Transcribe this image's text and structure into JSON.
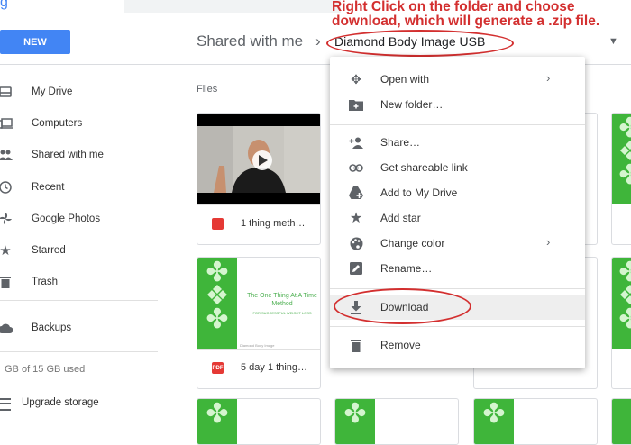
{
  "app": {
    "logo_fragment": "g",
    "new_button": "NEW"
  },
  "breadcrumb": {
    "parent": "Shared with me",
    "current_folder": "Diamond Body Image USB"
  },
  "annotation": {
    "line1": "Right Click on the folder and choose",
    "line2": "download, which will generate a .zip file."
  },
  "sidebar": {
    "items": [
      {
        "label": "My Drive",
        "icon": "my-drive-icon"
      },
      {
        "label": "Computers",
        "icon": "computers-icon"
      },
      {
        "label": "Shared with me",
        "icon": "shared-icon"
      },
      {
        "label": "Recent",
        "icon": "clock-icon"
      },
      {
        "label": "Google Photos",
        "icon": "photos-pinwheel-icon"
      },
      {
        "label": "Starred",
        "icon": "star-icon"
      },
      {
        "label": "Trash",
        "icon": "trash-icon"
      }
    ],
    "backups": "Backups",
    "storage": "GB of 15 GB used",
    "upgrade": "Upgrade storage"
  },
  "main": {
    "files_label": "Files",
    "files": [
      {
        "title": "1 thing meth…",
        "type": "video"
      },
      {
        "title": "5 day 1 thing…",
        "type": "pdf"
      }
    ],
    "doc_preview": {
      "title": "The One Thing At A Time Method",
      "subtitle": "FOR SUCCESSFUL WEIGHT LOSS",
      "small": "Diamond Body Image"
    }
  },
  "context_menu": {
    "items": [
      {
        "label": "Open with",
        "icon": "open-with-icon",
        "submenu": true
      },
      {
        "label": "New folder…",
        "icon": "new-folder-icon"
      },
      {
        "label": "Share…",
        "icon": "share-person-icon"
      },
      {
        "label": "Get shareable link",
        "icon": "link-icon"
      },
      {
        "label": "Add to My Drive",
        "icon": "add-to-drive-icon"
      },
      {
        "label": "Add star",
        "icon": "star-icon"
      },
      {
        "label": "Change color",
        "icon": "palette-icon",
        "submenu": true
      },
      {
        "label": "Rename…",
        "icon": "rename-icon"
      },
      {
        "label": "Download",
        "icon": "download-icon"
      },
      {
        "label": "Remove",
        "icon": "trash-icon"
      }
    ]
  },
  "colors": {
    "accent": "#4285f4",
    "annotation_red": "#d32f2f",
    "doc_green": "#3fb53a"
  }
}
